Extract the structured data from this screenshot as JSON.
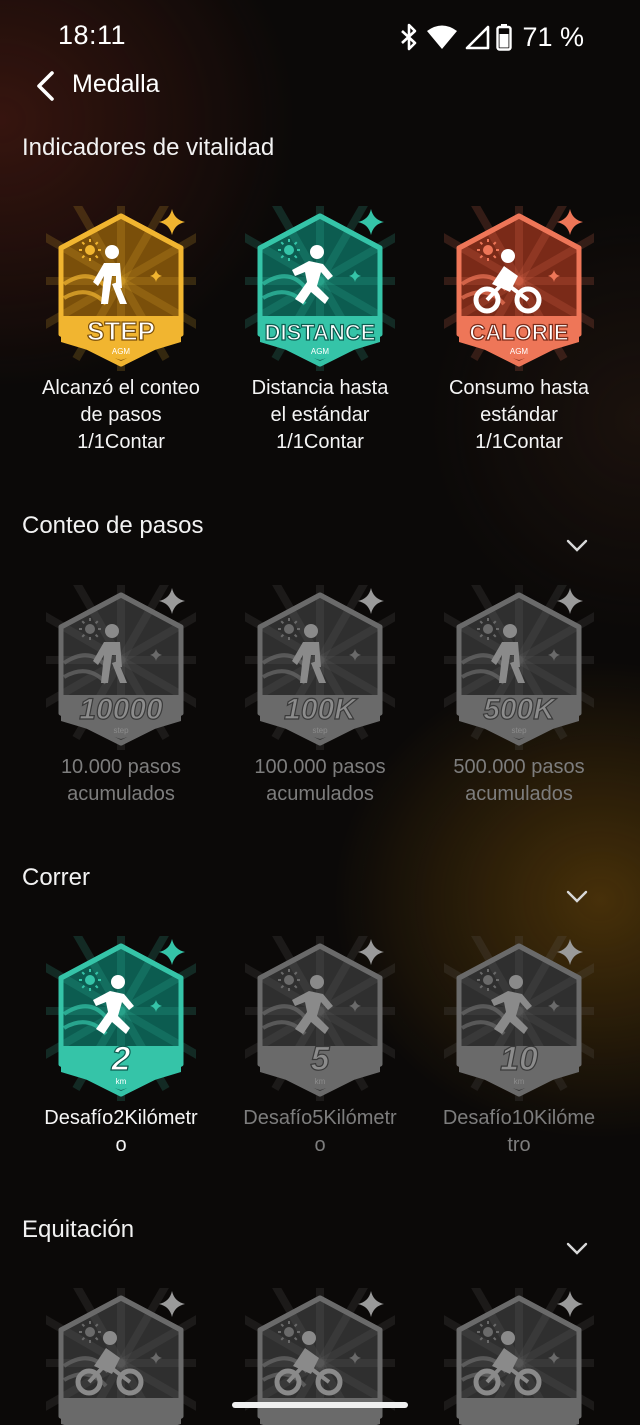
{
  "status_bar": {
    "time": "18:11",
    "battery": "71 %"
  },
  "header": {
    "title": "Medalla"
  },
  "sections": [
    {
      "title": "Indicadores de vitalidad"
    },
    {
      "title": "Conteo de pasos"
    },
    {
      "title": "Correr"
    },
    {
      "title": "Equitación"
    }
  ],
  "vitality": [
    {
      "badge_label": "STEP",
      "sub": "AGM",
      "caption_lines": [
        "Alcanzó el conteo",
        "de pasos",
        "1/1Contar"
      ],
      "color": "#f1b530",
      "dark": "#7a4f0a"
    },
    {
      "badge_label": "DISTANCE",
      "sub": "AGM",
      "caption_lines": [
        "Distancia hasta",
        "el estándar",
        "1/1Contar"
      ],
      "color": "#35c4a8",
      "dark": "#0c5c50"
    },
    {
      "badge_label": "CALORIE",
      "sub": "AGM",
      "caption_lines": [
        "Consumo hasta",
        "estándar",
        "1/1Contar"
      ],
      "color": "#ee7658",
      "dark": "#7a2a18"
    }
  ],
  "steps": [
    {
      "badge_label": "10000",
      "sub": "step",
      "caption_lines": [
        "10.000 pasos",
        "acumulados"
      ]
    },
    {
      "badge_label": "100K",
      "sub": "step",
      "caption_lines": [
        "100.000 pasos",
        "acumulados"
      ]
    },
    {
      "badge_label": "500K",
      "sub": "step",
      "caption_lines": [
        "500.000 pasos",
        "acumulados"
      ]
    }
  ],
  "running": [
    {
      "badge_label": "2",
      "sub": "km",
      "caption_lines": [
        "Desafío2Kilómetr",
        "o"
      ],
      "achieved": true,
      "color": "#35c4a8",
      "dark": "#0c5c50"
    },
    {
      "badge_label": "5",
      "sub": "km",
      "caption_lines": [
        "Desafío5Kilómetr",
        "o"
      ],
      "achieved": false
    },
    {
      "badge_label": "10",
      "sub": "km",
      "caption_lines": [
        "Desafío10Kilóme",
        "tro"
      ],
      "achieved": false
    }
  ],
  "icons": [
    "back-arrow-icon",
    "bluetooth-icon",
    "wifi-icon",
    "signal-icon",
    "battery-icon",
    "chevron-down-icon"
  ]
}
